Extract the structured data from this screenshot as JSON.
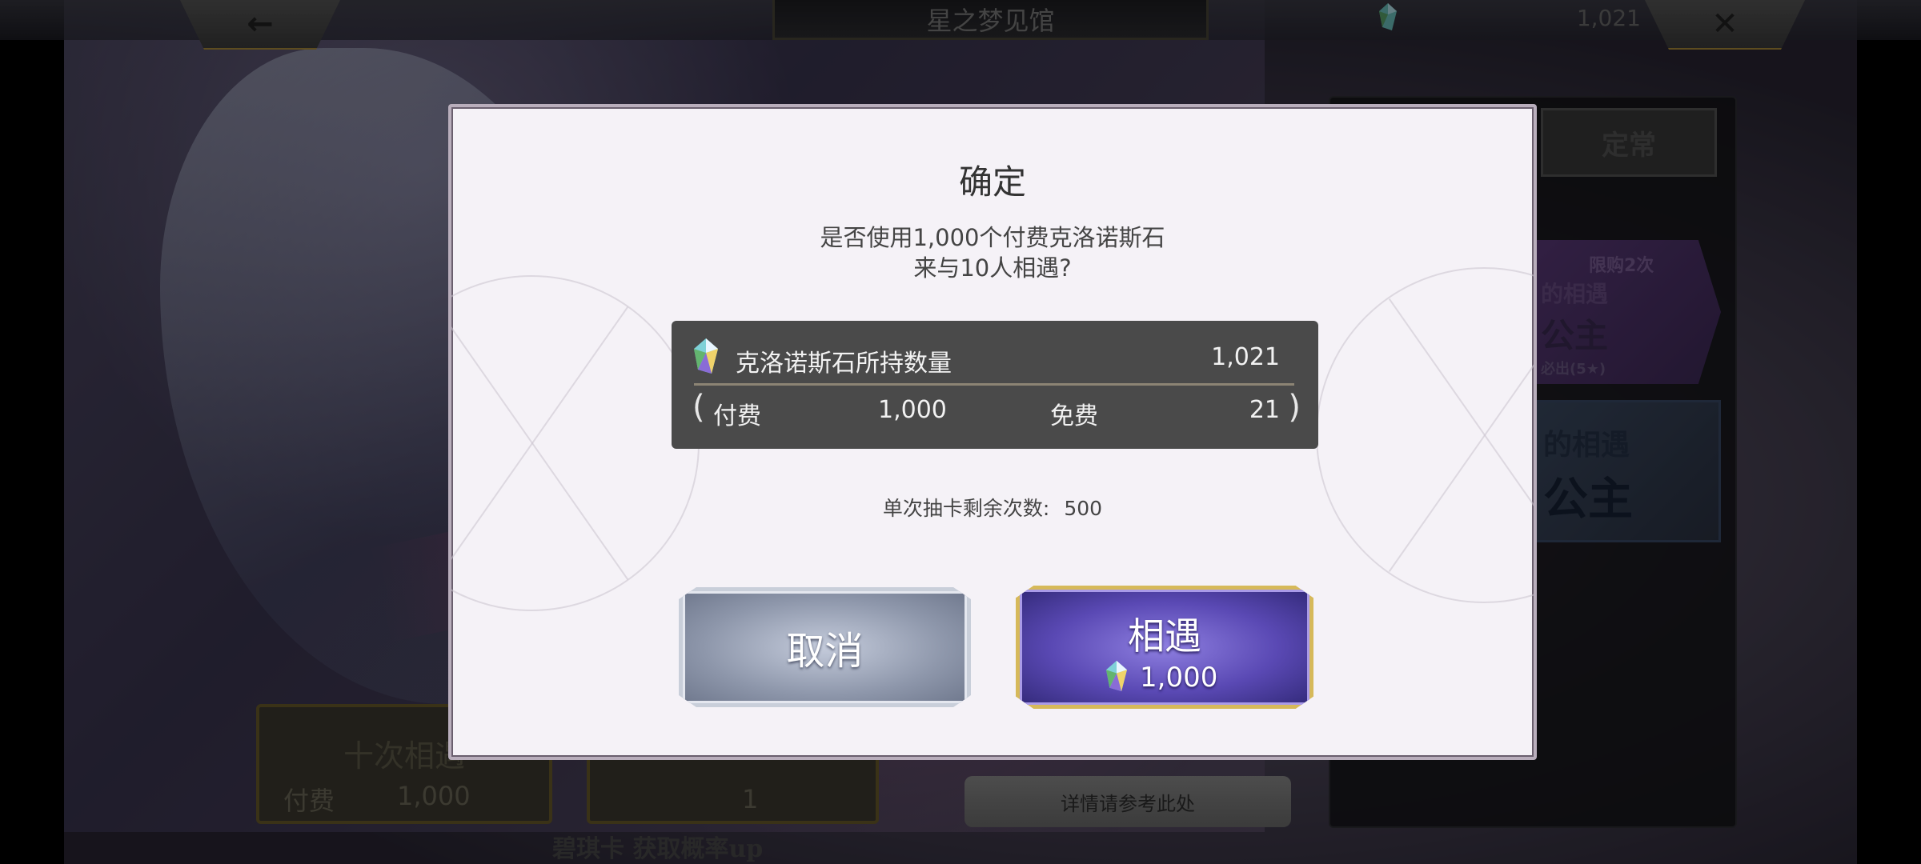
{
  "header": {
    "title": "星之梦见馆",
    "gem_count": "1,021",
    "back_icon": "←",
    "close_icon": "✕"
  },
  "background": {
    "tab_regular": "定常",
    "banner_limited_badge": "限购2次",
    "banner_1_line1": "的相遇",
    "banner_1_line2": "公主",
    "banner_1_line3": "必出(5★)",
    "banner_2_line1": "的相遇",
    "banner_2_line2": "公主",
    "ten_pull_label": "十次相遇",
    "ten_pull_paid": "付费",
    "ten_pull_cost": "1,000",
    "single_pull_cost": "1",
    "details_button": "详情请参考此处",
    "caption": "碧琪卡 获取概率up"
  },
  "dialog": {
    "title": "确定",
    "message_line1": "是否使用1,000个付费克洛诺斯石",
    "message_line2": "来与10人相遇?",
    "stones_label": "克洛诺斯石所持数量",
    "stones_total": "1,021",
    "paid_label": "付费",
    "paid_value": "1,000",
    "free_label": "免费",
    "free_value": "21",
    "remaining_label": "单次抽卡剩余次数:",
    "remaining_value": "500",
    "cancel_label": "取消",
    "confirm_label": "相遇",
    "confirm_cost": "1,000"
  },
  "icons": {
    "gem": "prism-gem-icon",
    "back": "arrow-left-icon",
    "close": "close-icon"
  },
  "colors": {
    "dialog_bg": "#f5f2f7",
    "stone_box_bg": "#4a4a4a",
    "confirm_purple": "#5a49b4",
    "confirm_gold_border": "#d6b95a",
    "cancel_silver": "#8e97ab"
  }
}
